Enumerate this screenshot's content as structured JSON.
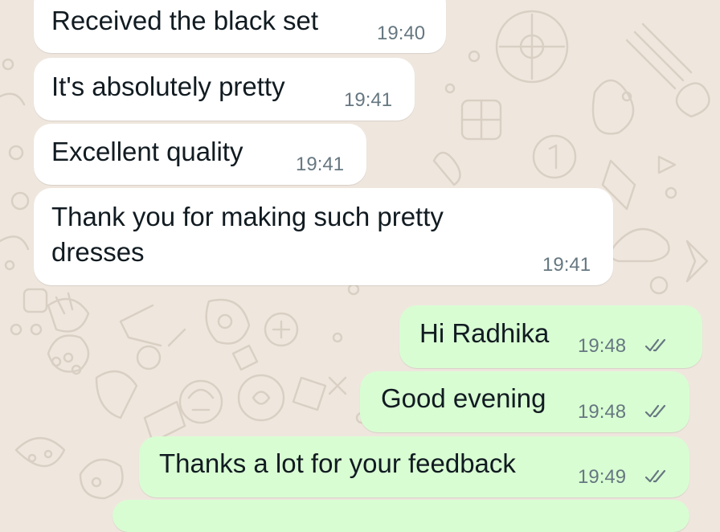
{
  "theme": {
    "wallpaper_color": "#efe7de",
    "incoming_bubble": "#ffffff",
    "outgoing_bubble": "#d9fdd3",
    "text_color": "#111b21",
    "time_color": "#667781"
  },
  "messages": [
    {
      "direction": "incoming",
      "text": "Received the black set",
      "time": "19:40"
    },
    {
      "direction": "incoming",
      "text": "It's absolutely pretty",
      "time": "19:41"
    },
    {
      "direction": "incoming",
      "text": "Excellent quality",
      "time": "19:41"
    },
    {
      "direction": "incoming",
      "text_line1": "Thank you for making such pretty",
      "text_line2": "dresses",
      "time": "19:41"
    },
    {
      "direction": "outgoing",
      "text": "Hi Radhika",
      "time": "19:48",
      "status_icon": "double-check-icon"
    },
    {
      "direction": "outgoing",
      "text": "Good evening",
      "time": "19:48",
      "status_icon": "double-check-icon"
    },
    {
      "direction": "outgoing",
      "text": "Thanks a lot for your feedback",
      "time": "19:49",
      "status_icon": "double-check-icon"
    }
  ]
}
